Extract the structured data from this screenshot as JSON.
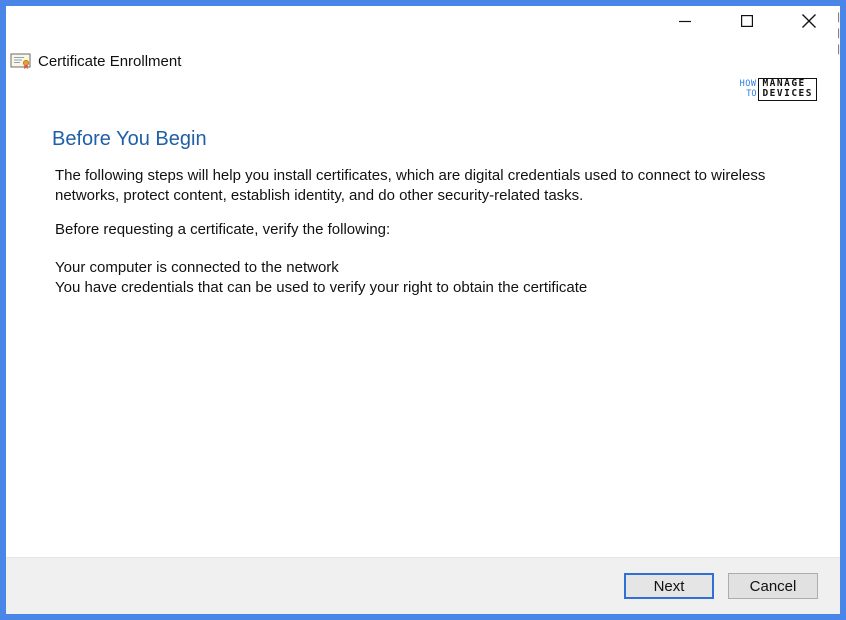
{
  "window": {
    "title": "Certificate Enrollment",
    "caption_buttons": [
      "minimize-icon",
      "maximize-icon",
      "close-icon"
    ]
  },
  "logo": {
    "how": "HOW",
    "to": "TO",
    "manage": "MANAGE",
    "devices": "DEVICES"
  },
  "page": {
    "heading": "Before You Begin",
    "intro": "The following steps will help you install certificates, which are digital credentials used to connect to wireless networks, protect content, establish identity, and do other security-related tasks.",
    "verify_label": "Before requesting a certificate, verify the following:",
    "requirements": [
      "Your computer is connected to the network",
      "You have credentials that can be used to verify your right to obtain the certificate"
    ]
  },
  "footer": {
    "next_label": "Next",
    "cancel_label": "Cancel"
  },
  "colors": {
    "frame": "#4a86e8",
    "heading": "#1f5fa8",
    "default_button_border": "#2f6fd6"
  }
}
